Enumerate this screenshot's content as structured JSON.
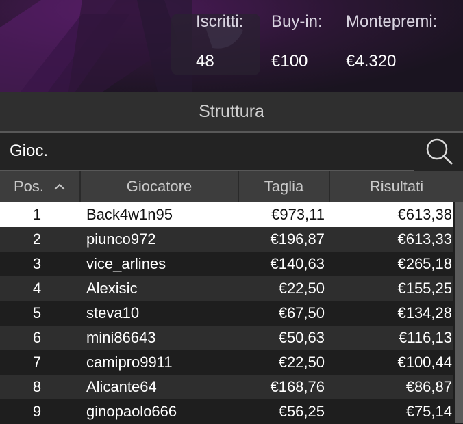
{
  "summary": {
    "registered_label": "Iscritti:",
    "registered_value": "48",
    "buyin_label": "Buy-in:",
    "buyin_value": "€100",
    "prize_label": "Montepremi:",
    "prize_value": "€4.320"
  },
  "structure_tab": "Struttura",
  "search": {
    "placeholder": "Gioc."
  },
  "table": {
    "headers": {
      "pos": "Pos.",
      "player": "Giocatore",
      "size": "Taglia",
      "results": "Risultati"
    },
    "rows": [
      {
        "pos": "1",
        "player": "Back4w1n95",
        "size": "€973,11",
        "result": "€613,38"
      },
      {
        "pos": "2",
        "player": "piunco972",
        "size": "€196,87",
        "result": "€613,33"
      },
      {
        "pos": "3",
        "player": "vice_arlines",
        "size": "€140,63",
        "result": "€265,18"
      },
      {
        "pos": "4",
        "player": "Alexisic",
        "size": "€22,50",
        "result": "€155,25"
      },
      {
        "pos": "5",
        "player": "steva10",
        "size": "€67,50",
        "result": "€134,28"
      },
      {
        "pos": "6",
        "player": "mini86643",
        "size": "€50,63",
        "result": "€116,13"
      },
      {
        "pos": "7",
        "player": "camipro9911",
        "size": "€22,50",
        "result": "€100,44"
      },
      {
        "pos": "8",
        "player": "Alicante64",
        "size": "€168,76",
        "result": "€86,87"
      },
      {
        "pos": "9",
        "player": "ginopaolo666",
        "size": "€56,25",
        "result": "€75,14"
      }
    ]
  }
}
